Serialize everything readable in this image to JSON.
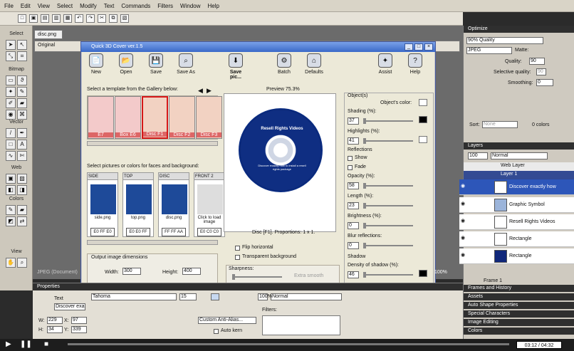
{
  "menu": [
    "File",
    "Edit",
    "View",
    "Select",
    "Modify",
    "Text",
    "Commands",
    "Filters",
    "Window",
    "Help"
  ],
  "document": {
    "tab": "disc.png",
    "original": "Original"
  },
  "dialog": {
    "title": "Quick 3D Cover ver.1.5",
    "toolbar": [
      "New",
      "Open",
      "Save",
      "Save As",
      "Save pic...",
      "Batch",
      "Defaults",
      "Assist",
      "Help"
    ],
    "gallery_label": "Select a template from the Gallery below:",
    "templates": [
      "E7",
      "Box E6",
      "Disc F1",
      "Disc F2",
      "Disc F3"
    ],
    "faces_label": "Select pictures or colors for faces and background:",
    "faces": [
      {
        "title": "SIDE",
        "file": "side.png",
        "hex": "E0 FF E0"
      },
      {
        "title": "TOP",
        "file": "top.png",
        "hex": "E0 E0 FF"
      },
      {
        "title": "DISC",
        "file": "disc.png",
        "hex": "FF FF AA"
      },
      {
        "title": "FRONT 2",
        "file": "Click to load image",
        "hex": "E0 C0 C0"
      }
    ],
    "preview_label": "Preview 75.3%",
    "disc_title": "Resell Rights Videos",
    "disc_sub": "Discover exactly how to install a resell rights package",
    "preview_caption": "Disc [F1]. Proportions: 1 x 1.",
    "flip": "Flip horizontal",
    "transparent": "Transparent background",
    "sharpness": "Sharpness:",
    "extra_smooth": "Extra smooth",
    "output": {
      "label": "Output image dimensions",
      "width_label": "Width:",
      "width": "300",
      "height_label": "Height:",
      "height": "400"
    },
    "object": {
      "label": "Object(s)",
      "color_label": "Object's color:",
      "shading_label": "Shading (%):",
      "shading": "37",
      "highlights_label": "Highlights (%):",
      "highlights": "41"
    },
    "reflections": {
      "label": "Reflections",
      "show": "Show",
      "fade": "Fade",
      "opacity_label": "Opacity (%):",
      "opacity": "58",
      "length_label": "Length (%):",
      "length": "23",
      "brightness_label": "Brightness (%):",
      "brightness": "0",
      "blur_label": "Blur reflections:",
      "blur": "0"
    },
    "shadow": {
      "label": "Shadow",
      "density_label": "Density of shadow (%):",
      "density": "46"
    }
  },
  "optimize": {
    "header": "Optimize",
    "quality_mode": "90% Quality",
    "format": "JPEG",
    "matte": "Matte:",
    "quality_label": "Quality:",
    "quality": "90",
    "selective": "Selective quality:",
    "selective_value": "90",
    "smoothing": "Smoothing:",
    "smoothing_value": "0"
  },
  "sort": {
    "label": "Sort:",
    "value": "None",
    "colors": "0 colors"
  },
  "layers": {
    "header": "Layers",
    "opacity": "100",
    "blend": "Normal",
    "items": [
      "Web Layer",
      "Layer 1",
      "Discover exactly how",
      "Graphic Symbol",
      "Resell Rights Videos",
      "Rectangle",
      "Rectangle"
    ],
    "frame": "Frame 1"
  },
  "panels": [
    "Frames and History",
    "Assets",
    "Auto Shape Properties",
    "Special Characters",
    "Image Editing",
    "Colors"
  ],
  "properties": {
    "header": "Properties",
    "type": "Text",
    "name": "Discover exa",
    "font": "Tahoma",
    "size": "15",
    "w": "229",
    "x": "97",
    "h": "34",
    "y": "339",
    "blend": "Normal",
    "alias": "Custom Anti-Alias...",
    "autokern": "Auto kern",
    "filters": "Filters:",
    "zoom": "100%"
  },
  "status": {
    "zoom": "100%",
    "jpeg": "JPEG (Document)"
  },
  "time": "03:12 / 04:32"
}
